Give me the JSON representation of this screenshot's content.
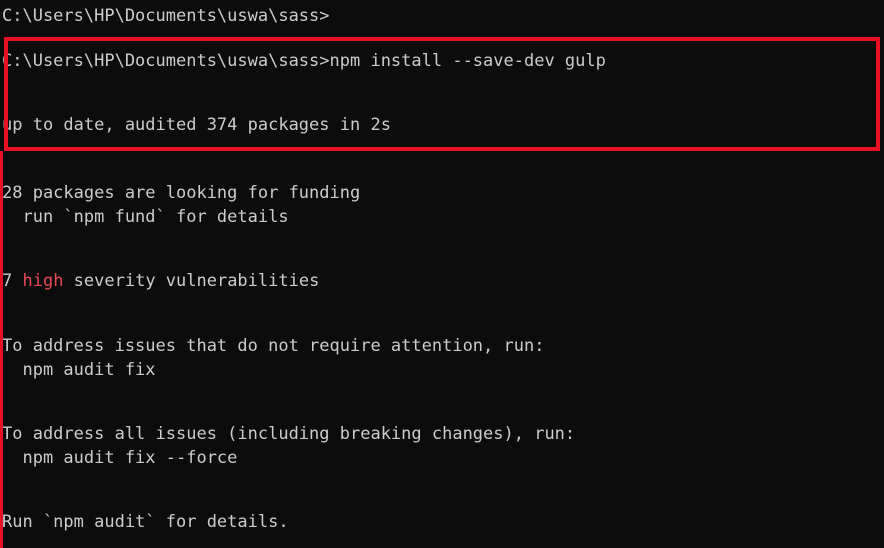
{
  "terminal": {
    "lines": [
      "C:\\Users\\HP\\Documents\\uswa\\sass>",
      "C:\\Users\\HP\\Documents\\uswa\\sass>npm install --save-dev gulp",
      "up to date, audited 374 packages in 2s",
      "28 packages are looking for funding",
      "  run `npm fund` for details",
      "To address issues that do not require attention, run:",
      "  npm audit fix",
      "To address all issues (including breaking changes), run:",
      "  npm audit fix --force",
      "Run `npm audit` for details."
    ],
    "vulnerability": {
      "count": "7 ",
      "severity": "high",
      "suffix": " severity vulnerabilities"
    }
  },
  "colors": {
    "background": "#0c0c0c",
    "text": "#cccccc",
    "severity_high": "#e74856",
    "highlight": "#e81123"
  }
}
